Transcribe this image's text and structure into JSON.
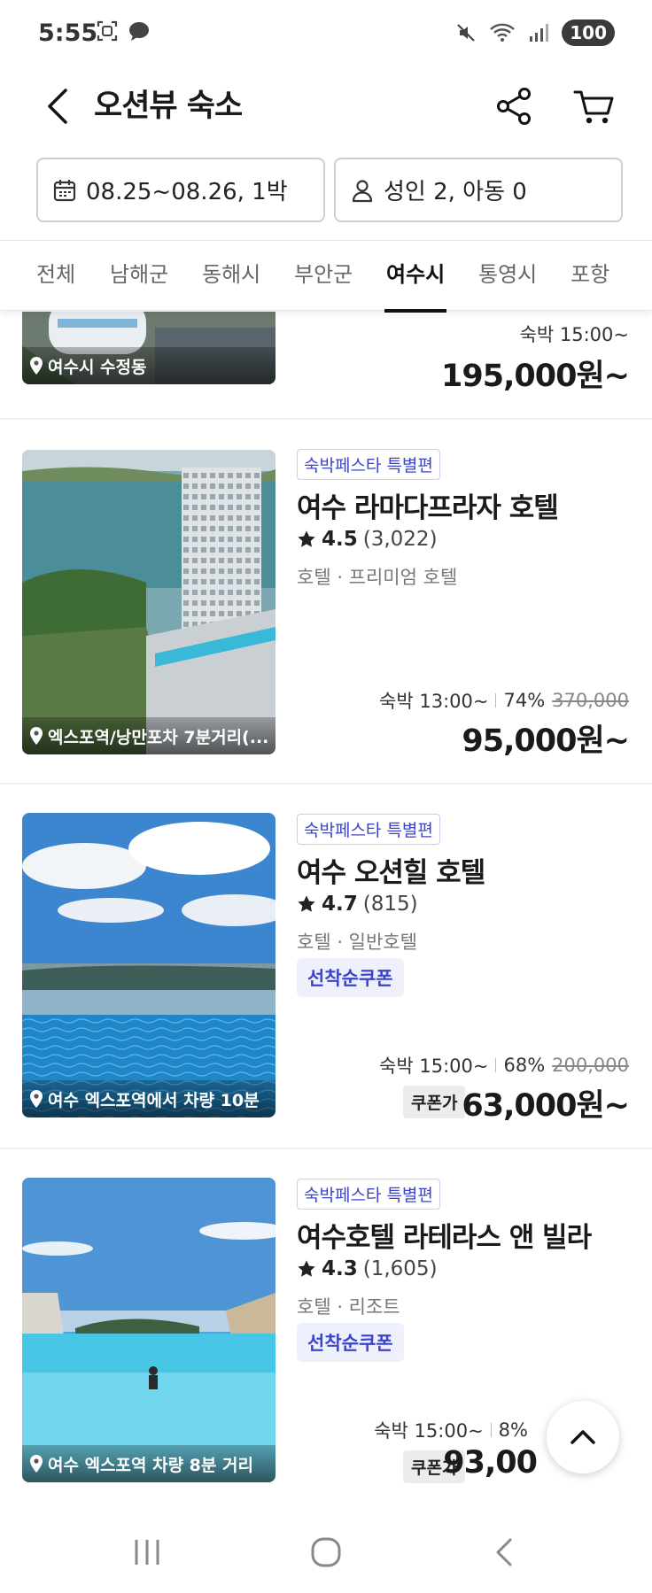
{
  "status_bar": {
    "time": "5:55",
    "battery": "100"
  },
  "header": {
    "title": "오션뷰 숙소"
  },
  "filters": {
    "date": "08.25~08.26, 1박",
    "guests": "성인 2, 아동 0"
  },
  "tabs": [
    {
      "label": "전체"
    },
    {
      "label": "남해군"
    },
    {
      "label": "동해시"
    },
    {
      "label": "부안군"
    },
    {
      "label": "여수시",
      "active": true
    },
    {
      "label": "통영시"
    },
    {
      "label": "포항"
    }
  ],
  "listings": [
    {
      "location": "여수시 수정동",
      "checkin": "숙박 15:00~",
      "price": "195,000원~"
    },
    {
      "badge": "숙박페스타 특별편",
      "name": "여수 라마다프라자 호텔",
      "rating": "4.5",
      "reviews": "(3,022)",
      "category": "호텔 · 프리미엄 호텔",
      "location": "엑스포역/낭만포차 7분거리(...",
      "checkin": "숙박 13:00~",
      "discount": "74%",
      "original_price": "370,000",
      "price": "95,000원~"
    },
    {
      "badge": "숙박페스타 특별편",
      "name": "여수 오션힐 호텔",
      "rating": "4.7",
      "reviews": "(815)",
      "category": "호텔 · 일반호텔",
      "coupon_chip": "선착순쿠폰",
      "location": "여수 엑스포역에서 차량 10분",
      "checkin": "숙박 15:00~",
      "discount": "68%",
      "original_price": "200,000",
      "coupon_tag": "쿠폰가",
      "price": "63,000원~"
    },
    {
      "badge": "숙박페스타 특별편",
      "name": "여수호텔 라테라스 앤 빌라",
      "rating": "4.3",
      "reviews": "(1,605)",
      "category": "호텔 · 리조트",
      "coupon_chip": "선착순쿠폰",
      "location": "여수 엑스포역 차량 8분 거리",
      "checkin": "숙박 15:00~",
      "discount": "8%",
      "coupon_tag": "쿠폰가",
      "price": "93,00"
    }
  ],
  "icons": {
    "back": "chevron-left-icon",
    "share": "share-icon",
    "cart": "cart-icon",
    "calendar": "calendar-icon",
    "person": "person-icon",
    "pin": "pin-icon",
    "star": "star-icon",
    "scroll_top": "chevron-up-icon"
  },
  "colors": {
    "accent": "#3b45c9",
    "text": "#1a1a1a",
    "muted": "#777777"
  }
}
